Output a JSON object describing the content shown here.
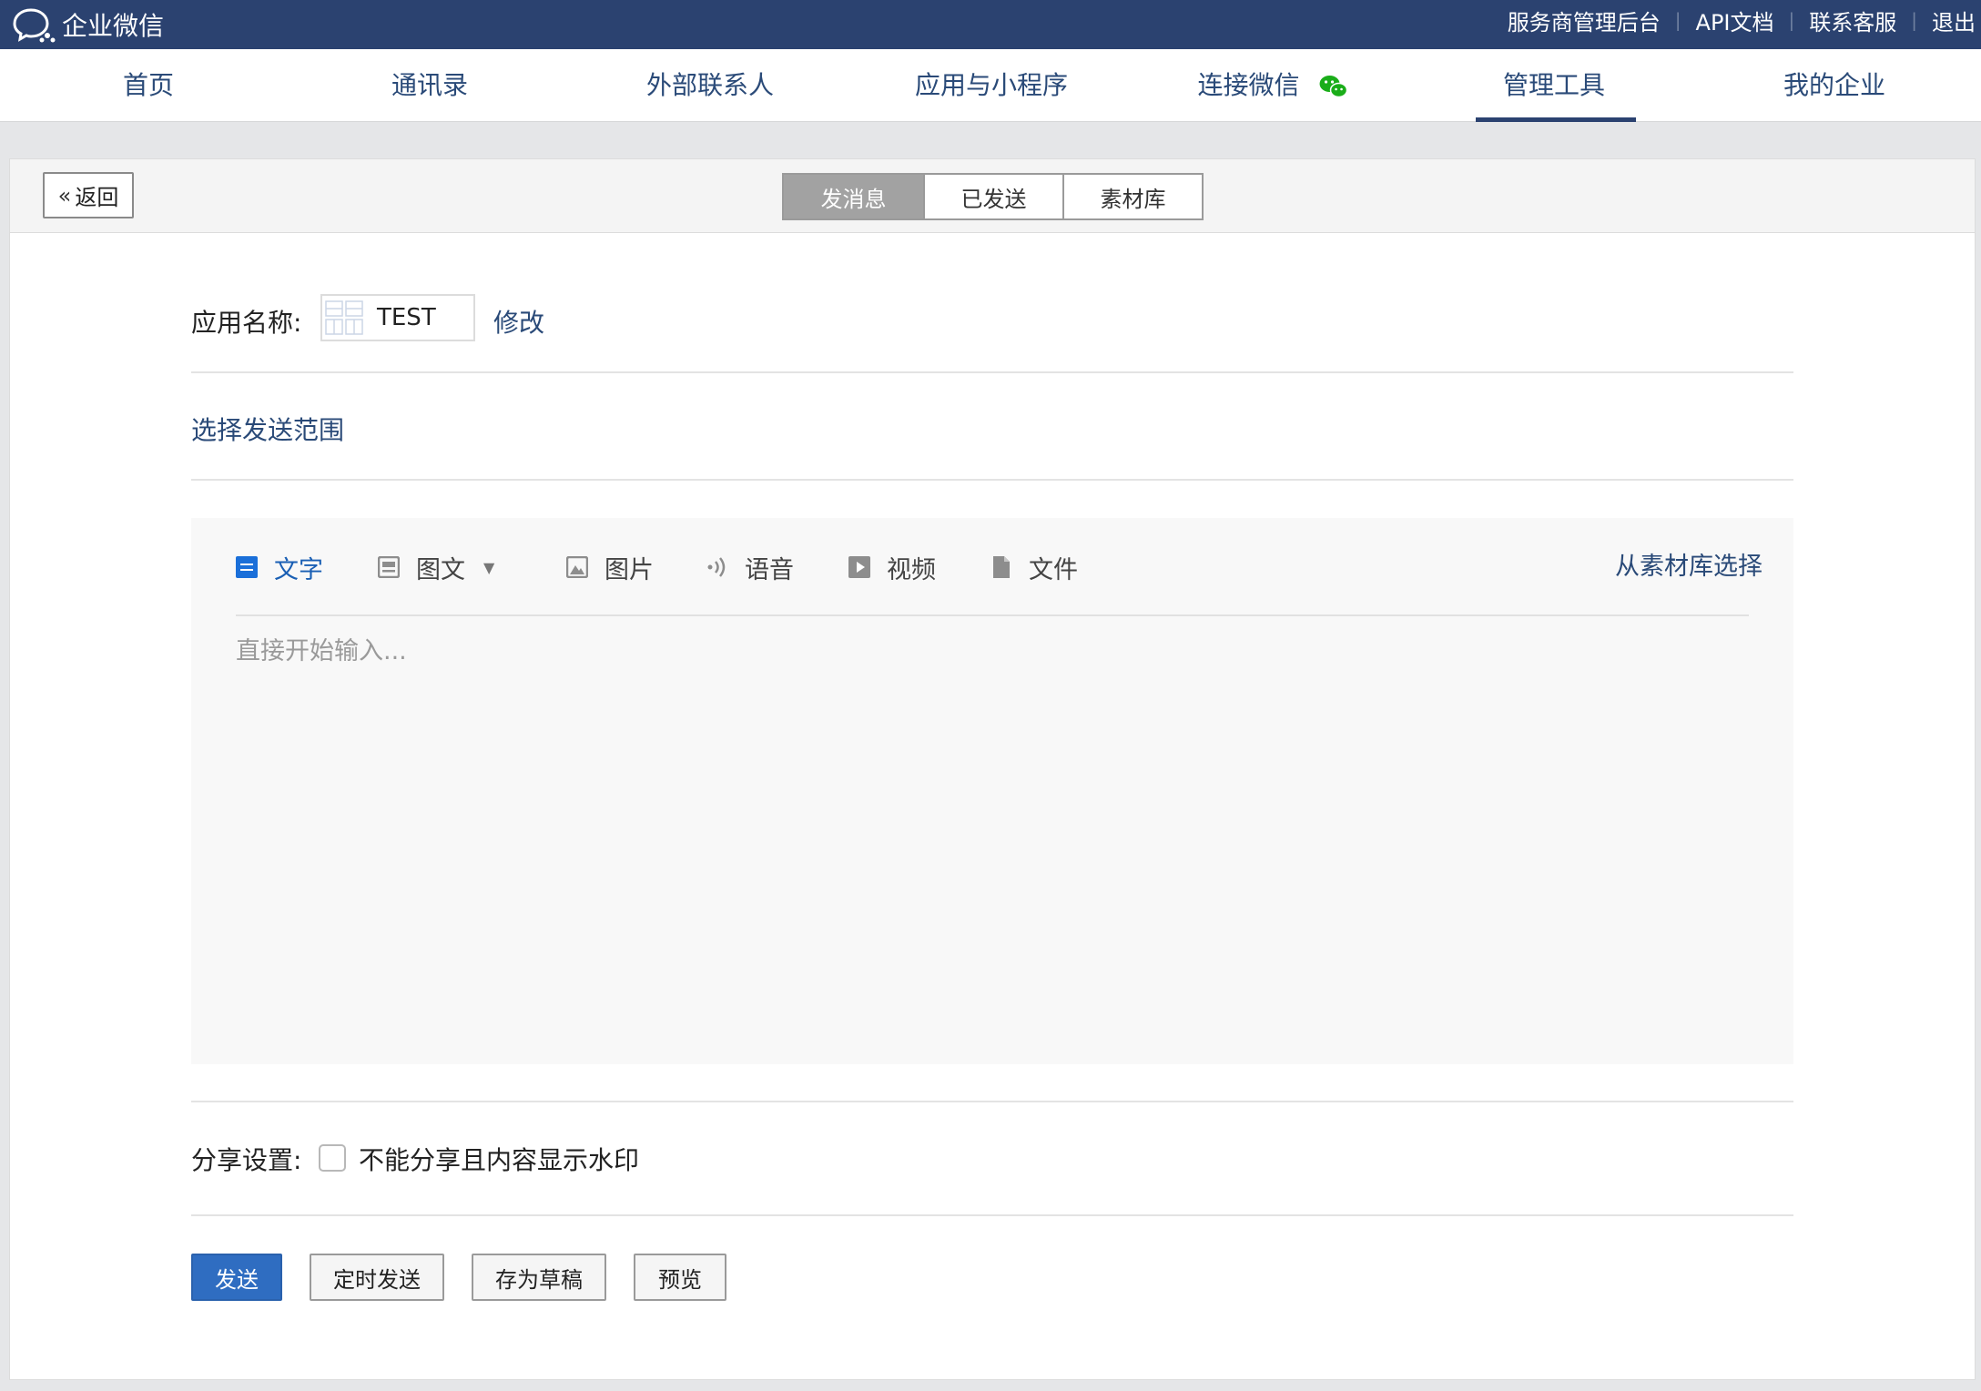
{
  "header": {
    "brand": "企业微信",
    "links": [
      "服务商管理后台",
      "API文档",
      "联系客服",
      "退出"
    ]
  },
  "nav": {
    "items": [
      "首页",
      "通讯录",
      "外部联系人",
      "应用与小程序",
      "连接微信",
      "管理工具",
      "我的企业"
    ],
    "active": "管理工具"
  },
  "toolbar": {
    "back_label": "返回",
    "tabs": [
      "发消息",
      "已发送",
      "素材库"
    ],
    "active_tab": "发消息"
  },
  "form": {
    "app_label": "应用名称:",
    "app_name": "TEST",
    "modify_label": "修改",
    "scope_label": "选择发送范围",
    "share_label": "分享设置:",
    "share_option": "不能分享且内容显示水印",
    "share_checked": false
  },
  "editor": {
    "tabs": [
      "文字",
      "图文",
      "图片",
      "语音",
      "视频",
      "文件"
    ],
    "active_tab": "文字",
    "from_library": "从素材库选择",
    "placeholder": "直接开始输入..."
  },
  "actions": {
    "send": "发送",
    "schedule": "定时发送",
    "draft": "存为草稿",
    "preview": "预览"
  },
  "colors": {
    "header_bg": "#2b4270",
    "link": "#2a4a78",
    "primary": "#2f6dc1",
    "active_editor_tab": "#1a5fb4"
  }
}
